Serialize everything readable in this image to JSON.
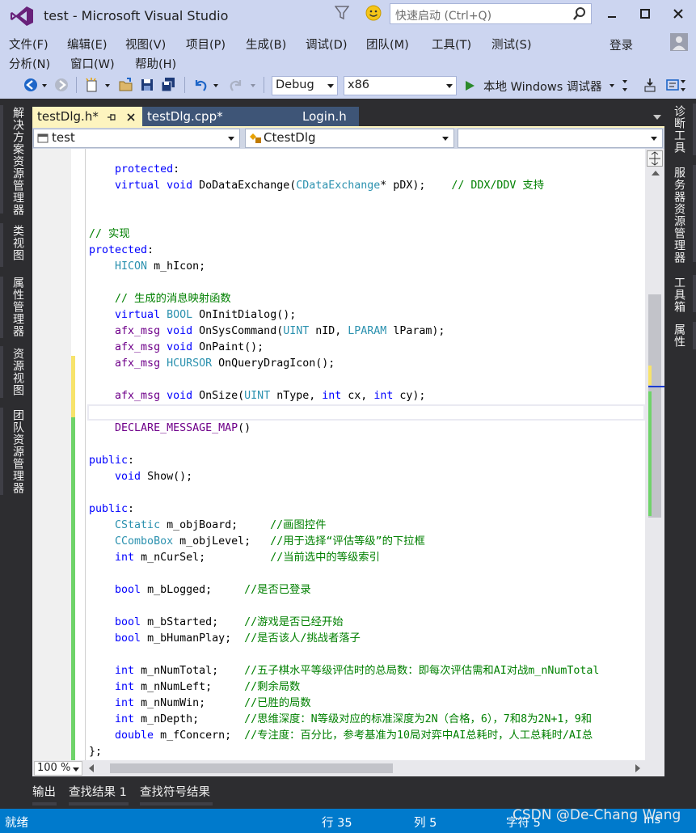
{
  "window": {
    "title": "test - Microsoft Visual Studio",
    "quick_launch_placeholder": "快速启动 (Ctrl+Q)",
    "login": "登录"
  },
  "menu": {
    "row1": [
      "文件(F)",
      "编辑(E)",
      "视图(V)",
      "项目(P)",
      "生成(B)",
      "调试(D)",
      "团队(M)",
      "工具(T)",
      "测试(S)"
    ],
    "row2": [
      "分析(N)",
      "窗口(W)",
      "帮助(H)"
    ]
  },
  "toolbar": {
    "configuration": "Debug",
    "platform": "x86",
    "run_label": "本地 Windows 调试器"
  },
  "left_rail": [
    "解决方案资源管理器",
    "类视图",
    "属性管理器",
    "资源视图",
    "团队资源管理器"
  ],
  "right_rail": [
    "诊断工具",
    "服务器资源管理器",
    "工具箱",
    "属性"
  ],
  "doc_tabs": [
    {
      "label": "testDlg.h*",
      "active": true
    },
    {
      "label": "testDlg.cpp*",
      "active": false
    },
    {
      "label": "Login.h",
      "active": false
    }
  ],
  "nav_bar": {
    "project": "test",
    "class": "CtestDlg",
    "member": ""
  },
  "code_lines": [
    "    protected:",
    "    virtual void DoDataExchange(CDataExchange* pDX);    // DDX/DDV 支持",
    "",
    "",
    "// 实现",
    "protected:",
    "    HICON m_hIcon;",
    "",
    "    // 生成的消息映射函数",
    "    virtual BOOL OnInitDialog();",
    "    afx_msg void OnSysCommand(UINT nID, LPARAM lParam);",
    "    afx_msg void OnPaint();",
    "    afx_msg HCURSOR OnQueryDragIcon();",
    "",
    "    afx_msg void OnSize(UINT nType, int cx, int cy);",
    "",
    "    DECLARE_MESSAGE_MAP()",
    "",
    "public:",
    "    void Show();",
    "",
    "public:",
    "    CStatic m_objBoard;     //画图控件",
    "    CComboBox m_objLevel;   //用于选择“评估等级”的下拉框",
    "    int m_nCurSel;          //当前选中的等级索引",
    "",
    "    bool m_bLogged;     //是否已登录",
    "",
    "    bool m_bStarted;    //游戏是否已经开始",
    "    bool m_bHumanPlay;  //是否该人/挑战者落子",
    "",
    "    int m_nNumTotal;    //五子棋水平等级评估时的总局数：即每次评估需和AI对战m_nNumTotal",
    "    int m_nNumLeft;     //剩余局数",
    "    int m_nNumWin;      //已胜的局数",
    "    int m_nDepth;       //思维深度：N等级对应的标准深度为2N（合格，6），7和8为2N+1，9和",
    "    double m_fConcern;  //专注度：百分比，参考基准为10局对弈中AI总耗时，人工总耗时/AI总",
    "};"
  ],
  "zoom": "100 %",
  "bottom_tabs": [
    "输出",
    "查找结果 1",
    "查找符号结果"
  ],
  "status": {
    "state": "就绪",
    "line": "行 35",
    "col": "列 5",
    "char": "字符 5",
    "mode": "Ins"
  },
  "watermark": "CSDN @De-Chang Wang",
  "colors": {
    "keyword": "#0000ff",
    "type": "#2b91af",
    "comment": "#008000",
    "macro": "#6f008a",
    "status_bar": "#007acc",
    "active_tab": "#fdf4bf"
  }
}
